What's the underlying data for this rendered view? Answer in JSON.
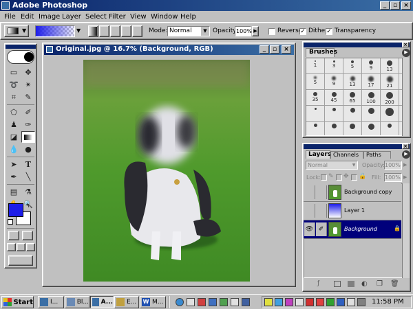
{
  "app": {
    "title": "Adobe Photoshop"
  },
  "menu": [
    "File",
    "Edit",
    "Image",
    "Layer",
    "Select",
    "Filter",
    "View",
    "Window",
    "Help"
  ],
  "options": {
    "mode_label": "Mode:",
    "mode_value": "Normal",
    "opacity_label": "Opacity:",
    "opacity_value": "100%",
    "reverse": "Reverse",
    "dither": "Dither",
    "transparency": "Transparency",
    "reverse_checked": false,
    "dither_checked": true,
    "transparency_checked": true
  },
  "document": {
    "title": "Original.jpg @ 16.7% (Background, RGB)"
  },
  "brushes": {
    "title": "Brushes",
    "rows": [
      [
        "1",
        "3",
        "5",
        "9",
        "13",
        "19"
      ],
      [
        "5",
        "9",
        "13",
        "17",
        "21",
        "27"
      ],
      [
        "35",
        "45",
        "65",
        "100",
        "200",
        "300"
      ]
    ]
  },
  "layers": {
    "tabs": [
      "Layers",
      "Channels",
      "Paths"
    ],
    "blend": "Normal",
    "opacity_label": "Opacity:",
    "opacity": "100%",
    "lock_label": "Lock:",
    "fill_label": "Fill:",
    "fill": "100%",
    "items": [
      {
        "name": "Background copy",
        "visible": false,
        "selected": false
      },
      {
        "name": "Layer 1",
        "visible": false,
        "selected": false
      },
      {
        "name": "Background",
        "visible": true,
        "selected": true
      }
    ]
  },
  "colors": {
    "foreground": "#1d1de8",
    "background": "#ffffff",
    "accent": "#0a246a",
    "selection": "#00007b"
  },
  "taskbar": {
    "start": "Start",
    "buttons": [
      "I...",
      "Bl...",
      "A...",
      "E...",
      "M..."
    ],
    "active_index": 2,
    "clock": "11:58 PM"
  }
}
